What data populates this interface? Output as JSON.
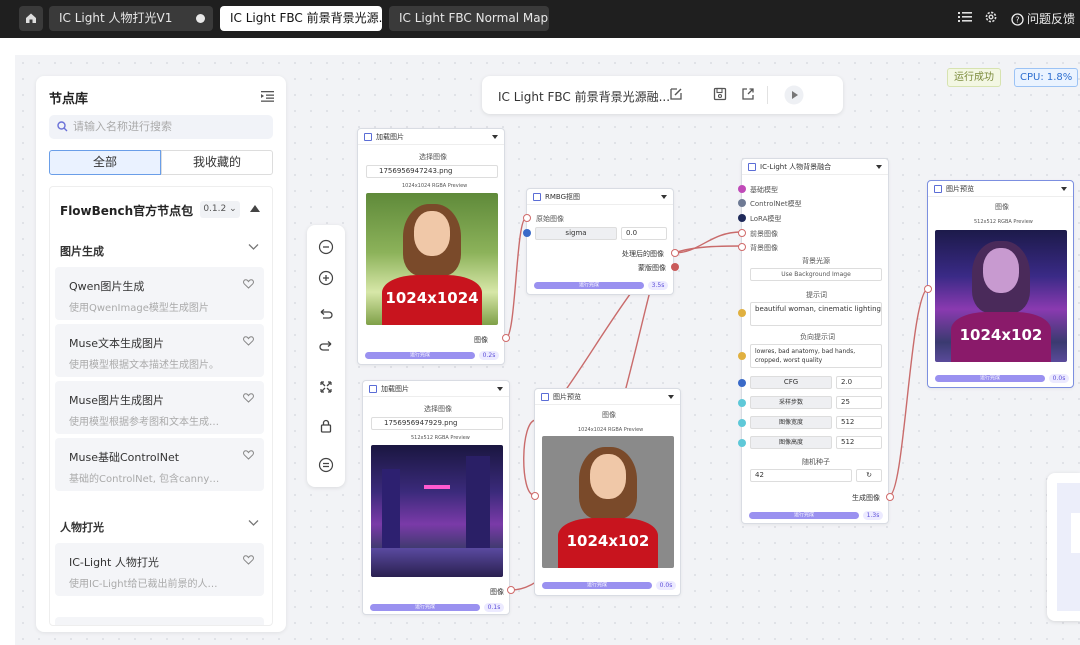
{
  "titlebar": {
    "tabs": [
      {
        "label": "IC Light 人物打光V1"
      },
      {
        "label": "IC Light FBC 前景背景光源..."
      },
      {
        "label": "IC Light FBC Normal Map:..."
      }
    ],
    "feedback_label": "问题反馈",
    "icons": [
      "home-icon",
      "list-icon",
      "gear-icon",
      "help-icon"
    ]
  },
  "library": {
    "title": "节点库",
    "search_placeholder": "请输入名称进行搜索",
    "seg_all": "全部",
    "seg_fav": "我收藏的",
    "package": {
      "title": "FlowBench官方节点包",
      "version": "0.1.2"
    },
    "sections": [
      {
        "title": "图片生成",
        "items": [
          {
            "name": "Qwen图片生成",
            "desc": "使用QwenImage模型生成图片"
          },
          {
            "name": "Muse文本生成图片",
            "desc": "使用模型根据文本描述生成图片。"
          },
          {
            "name": "Muse图片生成图片",
            "desc": "使用模型根据参考图和文本生成…"
          },
          {
            "name": "Muse基础ControlNet",
            "desc": "基础的ControlNet, 包含canny…"
          }
        ]
      },
      {
        "title": "人物打光",
        "items": [
          {
            "name": "IC-Light 人物打光",
            "desc": "使用IC-Light给已裁出前景的人…"
          }
        ]
      }
    ]
  },
  "top_controls": {
    "flow_name": "IC Light FBC 前景背景光源融..."
  },
  "status": {
    "run": "运行成功",
    "cpu": "CPU: 1.8%"
  },
  "nodes": {
    "load1": {
      "title": "加载图片",
      "select_label": "选择图像",
      "file": "1756956947243.png",
      "preview": "1024x1024 RGBA Preview",
      "shirt_text": "1024x1024",
      "output": "图像",
      "bar": "运行完成",
      "count": "0.2s"
    },
    "load2": {
      "title": "加载图片",
      "select_label": "选择图像",
      "file": "1756956947929.png",
      "preview": "512x512 RGBA Preview",
      "output": "图像",
      "bar": "运行完成",
      "count": "0.1s"
    },
    "rmbg": {
      "title": "RMBG抠图",
      "input": "原始图像",
      "param": "sigma",
      "param_val": "0.0",
      "out1": "处理后的图像",
      "out2": "蒙版图像",
      "bar": "运行完成",
      "count": "3.5s"
    },
    "preview1": {
      "title": "图片预览",
      "label": "图像",
      "preview": "1024x1024 RGBA Preview",
      "shirt_text": "1024x102",
      "bar": "运行完成",
      "count": "0.0s"
    },
    "iclight": {
      "title": "IC-Light 人物背景融合",
      "inputs": [
        "基础模型",
        "ControlNet模型",
        "LoRA模型",
        "前景图像",
        "背景图像"
      ],
      "bg_light_label": "背景光源",
      "bg_light_value": "Use Background Image",
      "prompt_label": "提示词",
      "prompt_value": "beautiful woman, cinematic lighting",
      "neg_label": "负向提示词",
      "neg_value": "lowres, bad anatomy, bad hands, cropped, worst quality",
      "params": [
        {
          "name": "CFG",
          "value": "2.0"
        },
        {
          "name": "采样步数",
          "value": "25"
        },
        {
          "name": "图像宽度",
          "value": "512"
        },
        {
          "name": "图像高度",
          "value": "512"
        }
      ],
      "seed_label": "随机种子",
      "seed_value": "42",
      "output": "生成图像",
      "bar": "运行完成",
      "count": "1.3s"
    },
    "preview2": {
      "title": "图片预览",
      "label": "图像",
      "preview": "512x512 RGBA Preview",
      "shirt_text": "1024x102",
      "bar": "运行完成",
      "count": "0.0s"
    }
  },
  "colors": {
    "accent": "#9a91f0",
    "wire": "#c96b6b",
    "titlebar": "#1f1f1f"
  }
}
